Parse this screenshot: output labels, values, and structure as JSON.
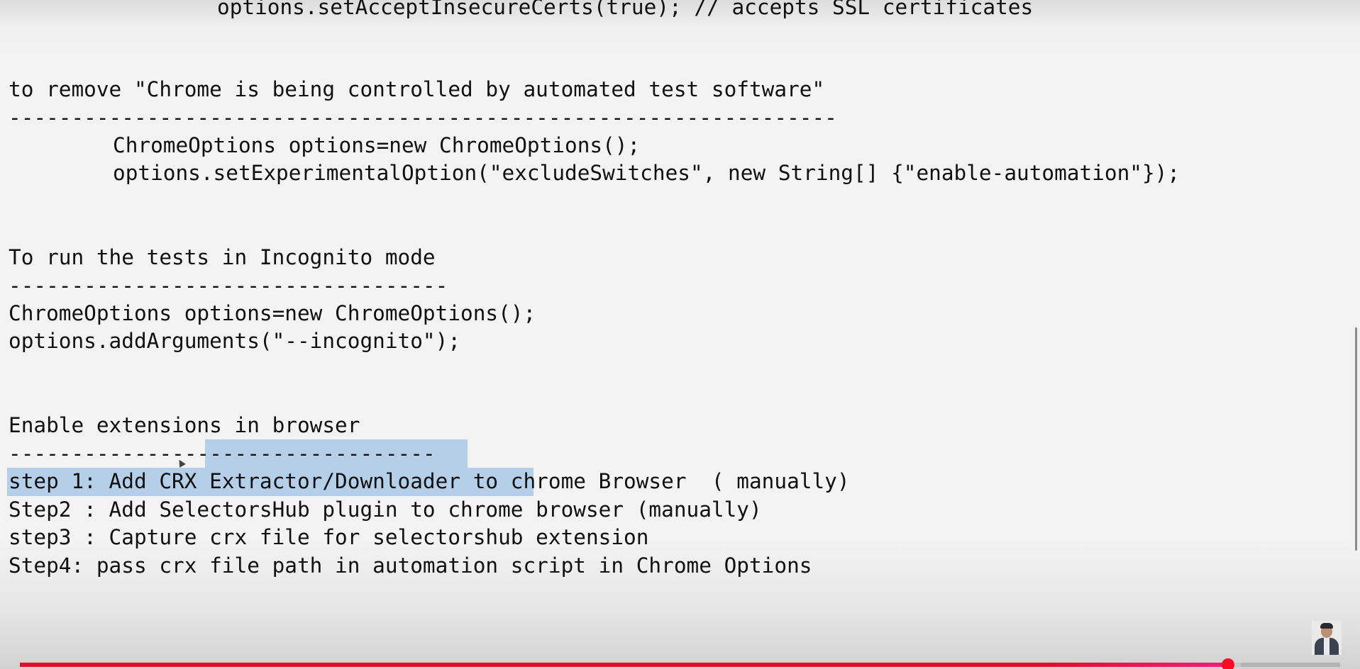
{
  "colors": {
    "background": "#f3f3f3",
    "text": "#111111",
    "selection": "#a9c8e6",
    "progress_played": "#e0102a",
    "progress_handle": "#ff0a23"
  },
  "document": {
    "prev_code_line": "options.setAcceptInsecureCerts(true); // accepts SSL certificates",
    "section1": {
      "heading": "to remove \"Chrome is being controlled by automated test software\"",
      "rule": "------------------------------------------------------------------",
      "code": [
        "ChromeOptions options=new ChromeOptions();",
        "options.setExperimentalOption(\"excludeSwitches\", new String[] {\"enable-automation\"});"
      ]
    },
    "section2": {
      "heading": "To run the tests in Incognito mode",
      "rule": "-----------------------------------",
      "code": [
        "ChromeOptions options=new ChromeOptions();",
        "options.addArguments(\"--incognito\");"
      ]
    },
    "section3": {
      "heading": "Enable extensions in browser",
      "rule": "----------------------------------",
      "steps": [
        "step 1: Add CRX Extractor/Downloader to chrome Browser  ( manually)",
        "Step2 : Add SelectorsHub plugin to chrome browser (manually)",
        "step3 : Capture crx file for selectorshub extension",
        "Step4: pass crx file path in automation script in Chrome Options"
      ]
    }
  },
  "player": {
    "progress_played_fraction": 0.915,
    "progress_buffered_fraction": 0.925,
    "presenter_avatar_icon": "presenter-avatar-icon"
  }
}
